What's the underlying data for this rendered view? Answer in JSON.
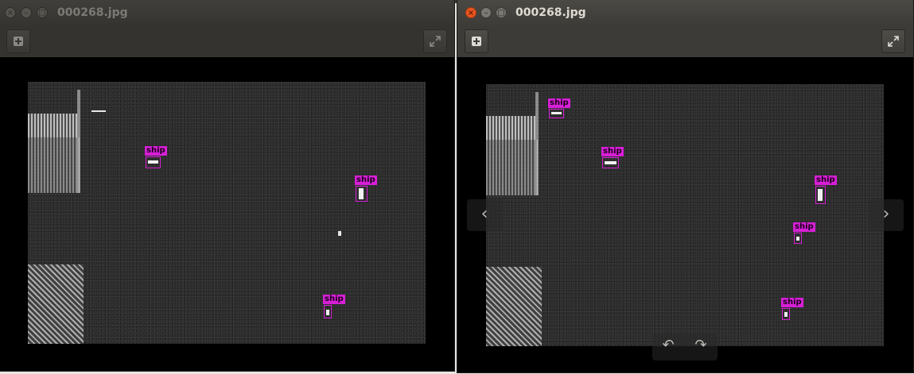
{
  "windows": [
    {
      "title": "000268.jpg",
      "active": false,
      "detections": [
        {
          "label": "ship"
        },
        {
          "label": "ship"
        },
        {
          "label": "ship"
        }
      ]
    },
    {
      "title": "000268.jpg",
      "active": true,
      "detections": [
        {
          "label": "ship"
        },
        {
          "label": "ship"
        },
        {
          "label": "ship"
        },
        {
          "label": "ship"
        },
        {
          "label": "ship"
        }
      ]
    }
  ],
  "icons": {
    "close": "close-icon",
    "minimize": "minimize-icon",
    "maximize": "maximize-icon",
    "add": "plus-icon",
    "fullscreen": "fullscreen-icon",
    "prev": "chevron-left-icon",
    "next": "chevron-right-icon",
    "rotate_left": "rotate-left-icon",
    "rotate_right": "rotate-right-icon"
  },
  "colors": {
    "detection": "#d61fd6",
    "titlebar": "#3c3b37",
    "close_active": "#e95420"
  }
}
